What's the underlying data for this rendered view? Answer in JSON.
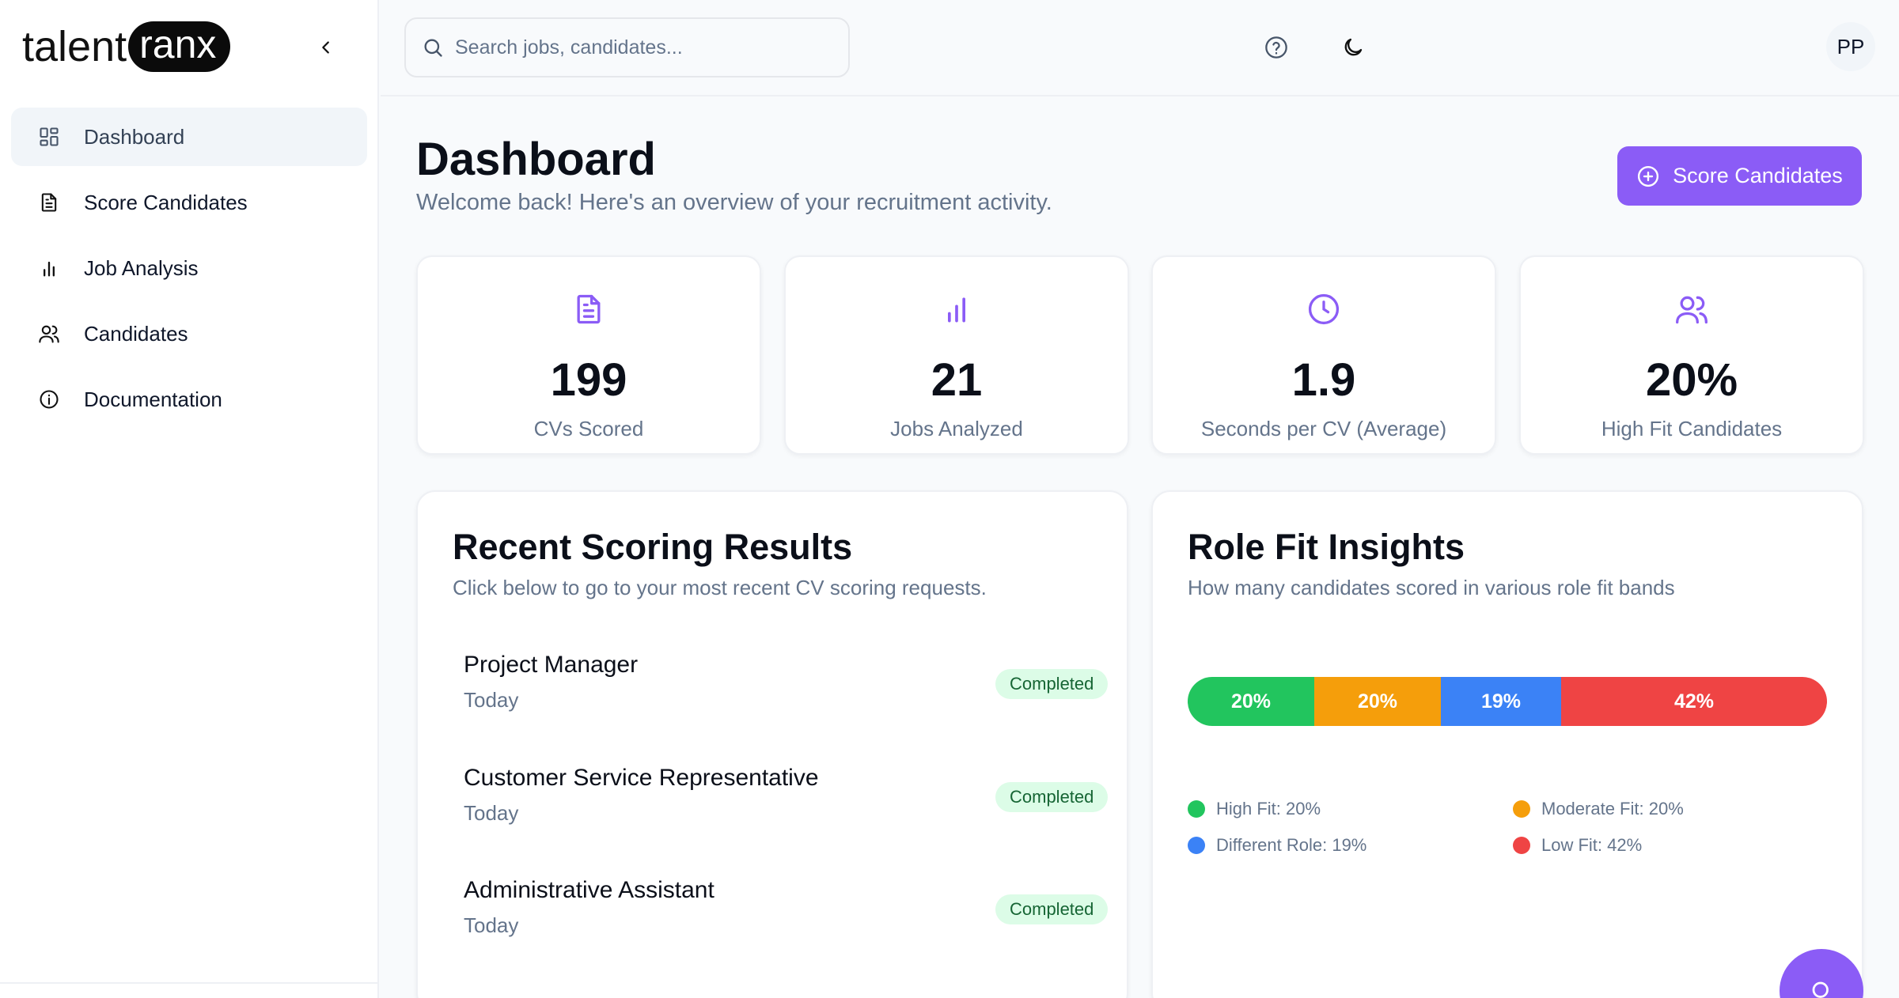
{
  "brand": {
    "part1": "talent",
    "part2": "ranx"
  },
  "sidebar": {
    "items": [
      {
        "label": "Dashboard",
        "icon": "layout-grid-icon"
      },
      {
        "label": "Score Candidates",
        "icon": "file-text-icon"
      },
      {
        "label": "Job Analysis",
        "icon": "bar-chart-icon"
      },
      {
        "label": "Candidates",
        "icon": "users-icon"
      },
      {
        "label": "Documentation",
        "icon": "info-icon"
      }
    ]
  },
  "topbar": {
    "search_placeholder": "Search jobs, candidates...",
    "avatar_initials": "PP"
  },
  "page": {
    "title": "Dashboard",
    "subtitle": "Welcome back! Here's an overview of your recruitment activity.",
    "primary_button": "Score Candidates"
  },
  "stats": [
    {
      "value": "199",
      "label": "CVs Scored",
      "icon": "file-text-icon"
    },
    {
      "value": "21",
      "label": "Jobs Analyzed",
      "icon": "bar-chart-icon"
    },
    {
      "value": "1.9",
      "label": "Seconds per CV (Average)",
      "icon": "clock-icon"
    },
    {
      "value": "20%",
      "label": "High Fit Candidates",
      "icon": "users-icon"
    }
  ],
  "recent": {
    "title": "Recent Scoring Results",
    "subtitle": "Click below to go to your most recent CV scoring requests.",
    "items": [
      {
        "name": "Project Manager",
        "date": "Today",
        "status": "Completed"
      },
      {
        "name": "Customer Service Representative",
        "date": "Today",
        "status": "Completed"
      },
      {
        "name": "Administrative Assistant",
        "date": "Today",
        "status": "Completed"
      }
    ]
  },
  "insights": {
    "title": "Role Fit Insights",
    "subtitle": "How many candidates scored in various role fit bands",
    "segments": [
      {
        "label": "20%",
        "value": 20,
        "color": "#22c55e"
      },
      {
        "label": "20%",
        "value": 20,
        "color": "#f59e0b"
      },
      {
        "label": "19%",
        "value": 19,
        "color": "#3b82f6"
      },
      {
        "label": "42%",
        "value": 42,
        "color": "#ef4444"
      }
    ],
    "legend": [
      {
        "text": "High Fit: 20%",
        "color": "#22c55e"
      },
      {
        "text": "Moderate Fit: 20%",
        "color": "#f59e0b"
      },
      {
        "text": "Different Role: 19%",
        "color": "#3b82f6"
      },
      {
        "text": "Low Fit: 42%",
        "color": "#ef4444"
      }
    ]
  },
  "colors": {
    "accent": "#8b5cf6",
    "success_bg": "#dcfce7",
    "success_text": "#166534"
  }
}
